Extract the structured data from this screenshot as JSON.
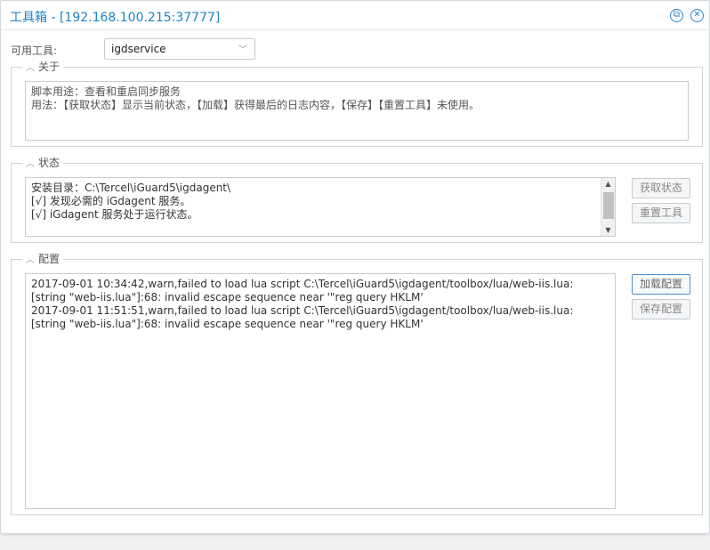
{
  "window": {
    "title": "工具箱 - [192.168.100.215:37777]",
    "restore_icon": "restore-icon",
    "close_icon": "close-icon"
  },
  "tool_selector": {
    "label": "可用工具:",
    "value": "igdservice"
  },
  "about": {
    "legend": "关于",
    "lines": [
      "脚本用途：查看和重启同步服务",
      "用法：【获取状态】显示当前状态，【加载】获得最后的日志内容，【保存】【重置工具】未使用。"
    ]
  },
  "status": {
    "legend": "状态",
    "lines": [
      "安装目录：C:\\Tercel\\iGuard5\\igdagent\\",
      "[√] 发现必需的 iGdagent 服务。",
      "[√] iGdagent 服务处于运行状态。"
    ],
    "buttons": {
      "get_status": "获取状态",
      "reset_tool": "重置工具"
    }
  },
  "config": {
    "legend": "配置",
    "log_lines": [
      "2017-09-01 10:34:42,warn,failed to load lua script C:\\Tercel\\iGuard5\\igdagent/toolbox/lua/web-iis.lua: [string \"web-iis.lua\"]:68: invalid escape sequence near '\"reg query HKLM'",
      "2017-09-01 11:51:51,warn,failed to load lua script C:\\Tercel\\iGuard5\\igdagent/toolbox/lua/web-iis.lua: [string \"web-iis.lua\"]:68: invalid escape sequence near '\"reg query HKLM'"
    ],
    "buttons": {
      "load_config": "加载配置",
      "save_config": "保存配置"
    }
  },
  "colors": {
    "title": "#1e83c5",
    "border": "#d0d4d8"
  }
}
